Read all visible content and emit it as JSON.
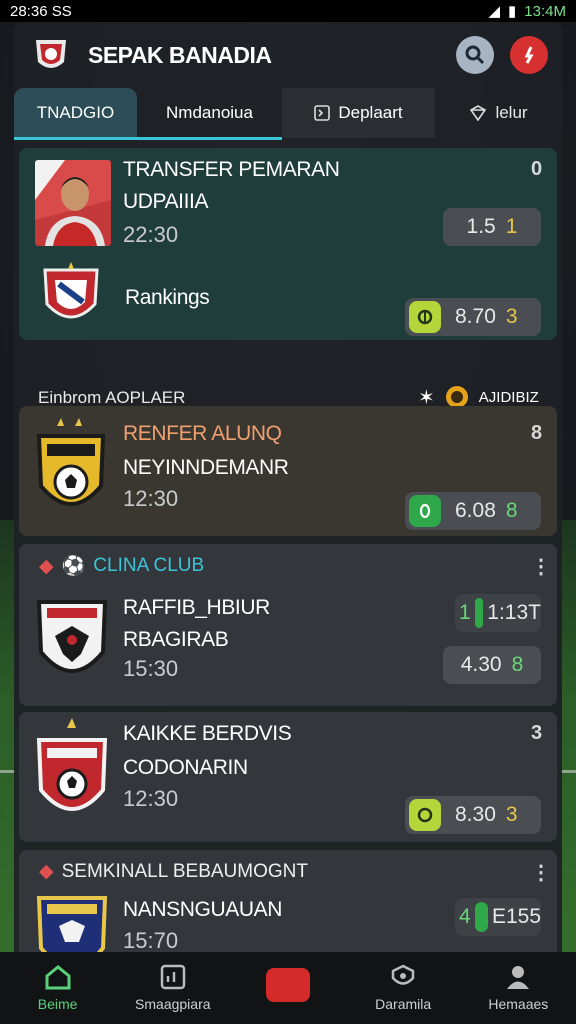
{
  "status_bar": {
    "time": "28:36 SS",
    "clock": "13:4M"
  },
  "header": {
    "title": "SEPAK BANADIA"
  },
  "tabs": [
    {
      "label": "TNADGIO"
    },
    {
      "label": "Nmdanoiua"
    },
    {
      "label": "Deplaart"
    },
    {
      "label": "lelur"
    }
  ],
  "card1": {
    "title_line1": "TRANSFER PEMARAN",
    "title_line2": "UDPAIIIA",
    "time": "22:30",
    "corner": "0",
    "pill1_value": "1.5",
    "pill1_prefix": "1",
    "pill1_accent": "1",
    "ranking_label": "Rankings",
    "pill2_value": "8.70",
    "pill2_accent": "3"
  },
  "section": {
    "label": "Einbrom AOPLAER",
    "right_label": "AJIDIBIZ"
  },
  "card2": {
    "title_line1": "RENFER ALUNQ",
    "title_line2": "NEYINNDEMANR",
    "time": "12:30",
    "corner": "8",
    "pill_value": "6.08",
    "pill_accent": "8"
  },
  "card3": {
    "club_label": "CLINA CLUB",
    "title_line1": "RAFFIB_HBIUR",
    "title_line2": "RBAGIRAB",
    "time": "15:30",
    "pill1_prefix": "1",
    "pill1_value": "1:13T",
    "pill2_value": "4.30",
    "pill2_accent": "8"
  },
  "card4": {
    "title_line1": "KAIKKE BERDVIS",
    "title_line2": "CODONARIN",
    "time": "12:30",
    "corner": "3",
    "pill_value": "8.30",
    "pill_accent": "3"
  },
  "card5": {
    "club_label": "SEMKINALL BEBAUMOGNT",
    "title_line1": "NANSNGUAUAN",
    "time": "15:70",
    "pill_prefix": "4",
    "pill_value": "E155"
  },
  "bottom_nav": [
    {
      "label": "Beime"
    },
    {
      "label": "Smaagpiara"
    },
    {
      "label": ""
    },
    {
      "label": "Daramila"
    },
    {
      "label": "Hemaaes"
    }
  ],
  "colors": {
    "accent": "#3cc4d8",
    "green": "#5ad07a",
    "red": "#d63030",
    "yellow": "#e8c64a"
  }
}
